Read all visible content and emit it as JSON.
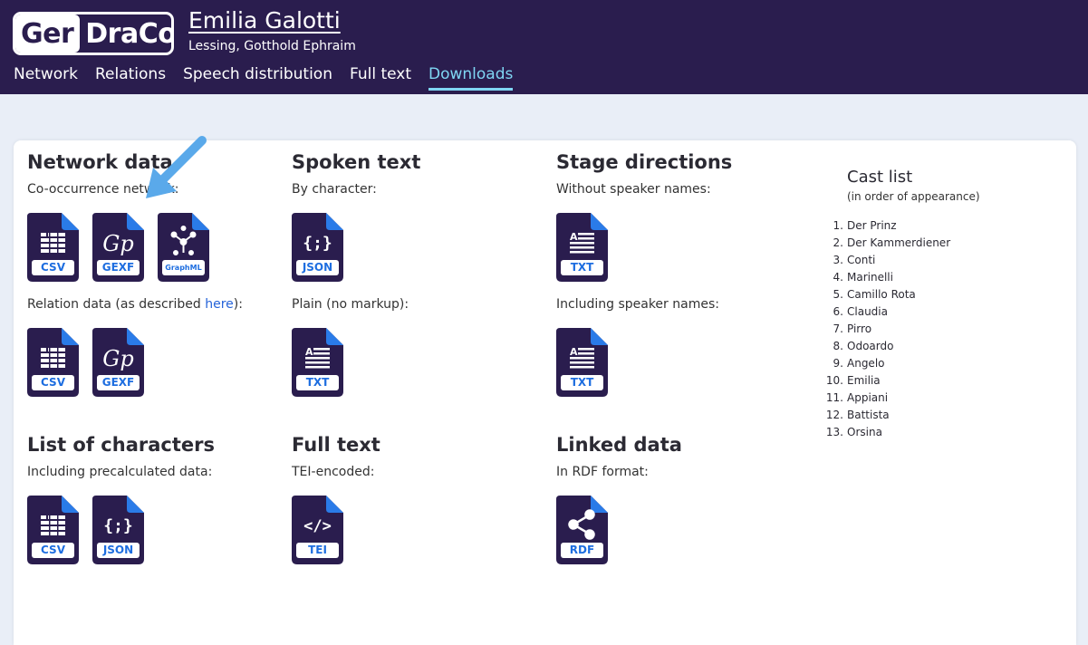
{
  "header": {
    "logo_left": "Ger",
    "logo_right": "DraCor",
    "title": "Emilia Galotti",
    "author": "Lessing, Gotthold Ephraim",
    "nav": [
      {
        "label": "Network",
        "active": false
      },
      {
        "label": "Relations",
        "active": false
      },
      {
        "label": "Speech distribution",
        "active": false
      },
      {
        "label": "Full text",
        "active": false
      },
      {
        "label": "Downloads",
        "active": true
      }
    ]
  },
  "sections": {
    "network": {
      "heading": "Network data",
      "cooccurrence_label": "Co-occurrence network:",
      "relation_prefix": "Relation data (as described ",
      "relation_link": "here",
      "relation_suffix": "):",
      "cooccurrence_icons": [
        "CSV",
        "GEXF",
        "GraphML"
      ],
      "relation_icons": [
        "CSV",
        "GEXF"
      ]
    },
    "spoken": {
      "heading": "Spoken text",
      "by_character_label": "By character:",
      "by_character_icon": "JSON",
      "plain_label": "Plain (no markup):",
      "plain_icon": "TXT"
    },
    "stage": {
      "heading": "Stage directions",
      "without_label": "Without speaker names:",
      "without_icon": "TXT",
      "including_label": "Including speaker names:",
      "including_icon": "TXT"
    },
    "characters": {
      "heading": "List of characters",
      "label": "Including precalculated data:",
      "icons": [
        "CSV",
        "JSON"
      ]
    },
    "fulltext": {
      "heading": "Full text",
      "label": "TEI-encoded:",
      "icon": "TEI"
    },
    "linked": {
      "heading": "Linked data",
      "label": "In RDF format:",
      "icon": "RDF"
    }
  },
  "cast": {
    "title": "Cast list",
    "note": "(in order of appearance)",
    "items": [
      {
        "num": "1.",
        "name": "Der Prinz"
      },
      {
        "num": "2.",
        "name": "Der Kammerdiener"
      },
      {
        "num": "3.",
        "name": "Conti"
      },
      {
        "num": "4.",
        "name": "Marinelli"
      },
      {
        "num": "5.",
        "name": "Camillo Rota"
      },
      {
        "num": "6.",
        "name": "Claudia"
      },
      {
        "num": "7.",
        "name": "Pirro"
      },
      {
        "num": "8.",
        "name": "Odoardo"
      },
      {
        "num": "9.",
        "name": "Angelo"
      },
      {
        "num": "10.",
        "name": "Emilia"
      },
      {
        "num": "11.",
        "name": "Appiani"
      },
      {
        "num": "12.",
        "name": "Battista"
      },
      {
        "num": "13.",
        "name": "Orsina"
      }
    ]
  },
  "colors": {
    "header_bg": "#2a1d4e",
    "nav_active": "#7fd6f3",
    "icon_body": "#2a1d4e",
    "icon_corner": "#2a7be8",
    "badge_text": "#1e6ee0",
    "link": "#2563d9",
    "arrow": "#5aa9ea"
  },
  "icons": {
    "csv": "spreadsheet-icon",
    "gexf": "gephi-icon",
    "graphml": "graph-nodes-icon",
    "json": "braces-icon",
    "txt": "text-document-icon",
    "tei": "code-tags-icon",
    "rdf": "share-nodes-icon"
  }
}
